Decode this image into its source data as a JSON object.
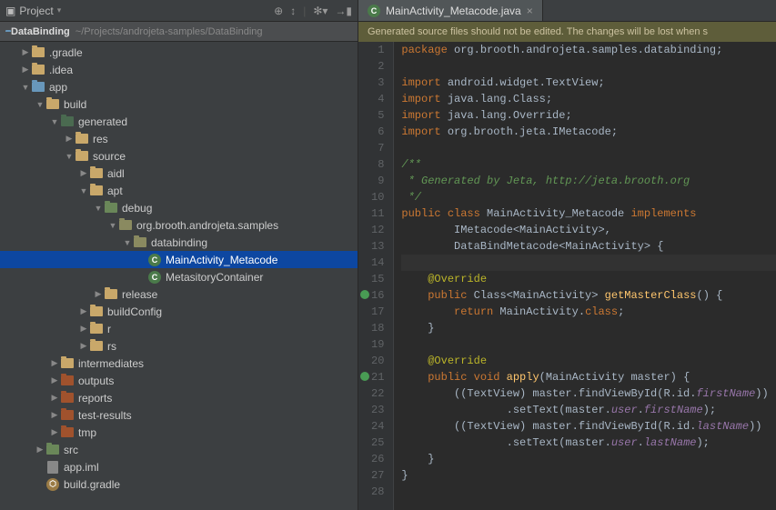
{
  "sidebar": {
    "title": "Project",
    "breadcrumb": {
      "root": "DataBinding",
      "path": "~/Projects/androjeta-samples/DataBinding"
    },
    "toolIcons": [
      "target",
      "collapse",
      "gear",
      "hide"
    ],
    "tree": [
      {
        "d": 1,
        "a": "right",
        "ico": "folder",
        "lbl": ".gradle"
      },
      {
        "d": 1,
        "a": "right",
        "ico": "folder",
        "lbl": ".idea"
      },
      {
        "d": 1,
        "a": "down",
        "ico": "module",
        "lbl": "app"
      },
      {
        "d": 2,
        "a": "down",
        "ico": "folder",
        "lbl": "build"
      },
      {
        "d": 3,
        "a": "down",
        "ico": "gen",
        "lbl": "generated"
      },
      {
        "d": 4,
        "a": "right",
        "ico": "folder",
        "lbl": "res"
      },
      {
        "d": 4,
        "a": "down",
        "ico": "folder",
        "lbl": "source"
      },
      {
        "d": 5,
        "a": "right",
        "ico": "folder",
        "lbl": "aidl"
      },
      {
        "d": 5,
        "a": "down",
        "ico": "folder",
        "lbl": "apt"
      },
      {
        "d": 6,
        "a": "down",
        "ico": "src",
        "lbl": "debug"
      },
      {
        "d": 7,
        "a": "down",
        "ico": "pkg",
        "lbl": "org.brooth.androjeta.samples"
      },
      {
        "d": 8,
        "a": "down",
        "ico": "pkg",
        "lbl": "databinding"
      },
      {
        "d": 9,
        "a": "",
        "ico": "class",
        "lbl": "MainActivity_Metacode",
        "sel": true
      },
      {
        "d": 9,
        "a": "",
        "ico": "class",
        "lbl": "MetasitoryContainer"
      },
      {
        "d": 6,
        "a": "right",
        "ico": "folder",
        "lbl": "release"
      },
      {
        "d": 5,
        "a": "right",
        "ico": "folder",
        "lbl": "buildConfig"
      },
      {
        "d": 5,
        "a": "right",
        "ico": "folder",
        "lbl": "r"
      },
      {
        "d": 5,
        "a": "right",
        "ico": "folder",
        "lbl": "rs"
      },
      {
        "d": 3,
        "a": "right",
        "ico": "folder",
        "lbl": "intermediates"
      },
      {
        "d": 3,
        "a": "right",
        "ico": "excl",
        "lbl": "outputs"
      },
      {
        "d": 3,
        "a": "right",
        "ico": "excl",
        "lbl": "reports"
      },
      {
        "d": 3,
        "a": "right",
        "ico": "excl",
        "lbl": "test-results"
      },
      {
        "d": 3,
        "a": "right",
        "ico": "excl",
        "lbl": "tmp"
      },
      {
        "d": 2,
        "a": "right",
        "ico": "src",
        "lbl": "src"
      },
      {
        "d": 2,
        "a": "",
        "ico": "file",
        "lbl": "app.iml"
      },
      {
        "d": 2,
        "a": "",
        "ico": "gradle",
        "lbl": "build.gradle"
      }
    ]
  },
  "editor": {
    "tab": {
      "icon": "C",
      "filename": "MainActivity_Metacode.java"
    },
    "banner": "Generated source files should not be edited. The changes will be lost when s",
    "gutterMarks": [
      16,
      21
    ],
    "lines": [
      {
        "n": 1,
        "t": [
          [
            "kw",
            "package"
          ],
          [
            "",
            " org.brooth.androjeta.samples.databinding;"
          ]
        ]
      },
      {
        "n": 2,
        "t": [
          [
            "",
            ""
          ]
        ]
      },
      {
        "n": 3,
        "t": [
          [
            "kw",
            "import"
          ],
          [
            "",
            " android.widget.TextView;"
          ]
        ]
      },
      {
        "n": 4,
        "t": [
          [
            "kw",
            "import"
          ],
          [
            "",
            " java.lang.Class;"
          ]
        ]
      },
      {
        "n": 5,
        "t": [
          [
            "kw",
            "import"
          ],
          [
            "",
            " java.lang.Override;"
          ]
        ]
      },
      {
        "n": 6,
        "t": [
          [
            "kw",
            "import"
          ],
          [
            "",
            " org.brooth.jeta.IMetacode;"
          ]
        ]
      },
      {
        "n": 7,
        "t": [
          [
            "",
            ""
          ]
        ]
      },
      {
        "n": 8,
        "t": [
          [
            "cmt",
            "/**"
          ]
        ]
      },
      {
        "n": 9,
        "t": [
          [
            "cmt",
            " * Generated by Jeta, http://jeta.brooth.org"
          ]
        ]
      },
      {
        "n": 10,
        "t": [
          [
            "cmt",
            " */"
          ]
        ]
      },
      {
        "n": 11,
        "t": [
          [
            "kw",
            "public class"
          ],
          [
            "",
            " MainActivity_Metacode "
          ],
          [
            "kw",
            "implements"
          ]
        ]
      },
      {
        "n": 12,
        "t": [
          [
            "",
            "        IMetacode<MainActivity>,"
          ]
        ]
      },
      {
        "n": 13,
        "t": [
          [
            "",
            "        DataBindMetacode<MainActivity> {"
          ]
        ]
      },
      {
        "n": 14,
        "cur": true,
        "t": [
          [
            "",
            ""
          ]
        ]
      },
      {
        "n": 15,
        "t": [
          [
            "",
            "    "
          ],
          [
            "ann",
            "@Override"
          ]
        ]
      },
      {
        "n": 16,
        "t": [
          [
            "",
            "    "
          ],
          [
            "kw",
            "public"
          ],
          [
            "",
            " Class<MainActivity> "
          ],
          [
            "fn",
            "getMasterClass"
          ],
          [
            "",
            "() {"
          ]
        ]
      },
      {
        "n": 17,
        "t": [
          [
            "",
            "        "
          ],
          [
            "kw",
            "return"
          ],
          [
            "",
            " MainActivity."
          ],
          [
            "kw",
            "class"
          ],
          [
            "",
            ";"
          ]
        ]
      },
      {
        "n": 18,
        "t": [
          [
            "",
            "    }"
          ]
        ]
      },
      {
        "n": 19,
        "t": [
          [
            "",
            ""
          ]
        ]
      },
      {
        "n": 20,
        "t": [
          [
            "",
            "    "
          ],
          [
            "ann",
            "@Override"
          ]
        ]
      },
      {
        "n": 21,
        "t": [
          [
            "",
            "    "
          ],
          [
            "kw",
            "public void "
          ],
          [
            "fn",
            "apply"
          ],
          [
            "",
            "(MainActivity master) {"
          ]
        ]
      },
      {
        "n": 22,
        "t": [
          [
            "",
            "        ((TextView) master.findViewById(R.id."
          ],
          [
            "fld",
            "firstName"
          ],
          [
            "",
            "))"
          ]
        ]
      },
      {
        "n": 23,
        "t": [
          [
            "",
            "                .setText(master."
          ],
          [
            "fld",
            "user"
          ],
          [
            "",
            "."
          ],
          [
            "fld",
            "firstName"
          ],
          [
            "",
            ");"
          ]
        ]
      },
      {
        "n": 24,
        "t": [
          [
            "",
            "        ((TextView) master.findViewById(R.id."
          ],
          [
            "fld",
            "lastName"
          ],
          [
            "",
            "))"
          ]
        ]
      },
      {
        "n": 25,
        "t": [
          [
            "",
            "                .setText(master."
          ],
          [
            "fld",
            "user"
          ],
          [
            "",
            "."
          ],
          [
            "fld",
            "lastName"
          ],
          [
            "",
            ");"
          ]
        ]
      },
      {
        "n": 26,
        "t": [
          [
            "",
            "    }"
          ]
        ]
      },
      {
        "n": 27,
        "t": [
          [
            "",
            "}"
          ]
        ]
      },
      {
        "n": 28,
        "t": [
          [
            "",
            ""
          ]
        ]
      }
    ]
  }
}
